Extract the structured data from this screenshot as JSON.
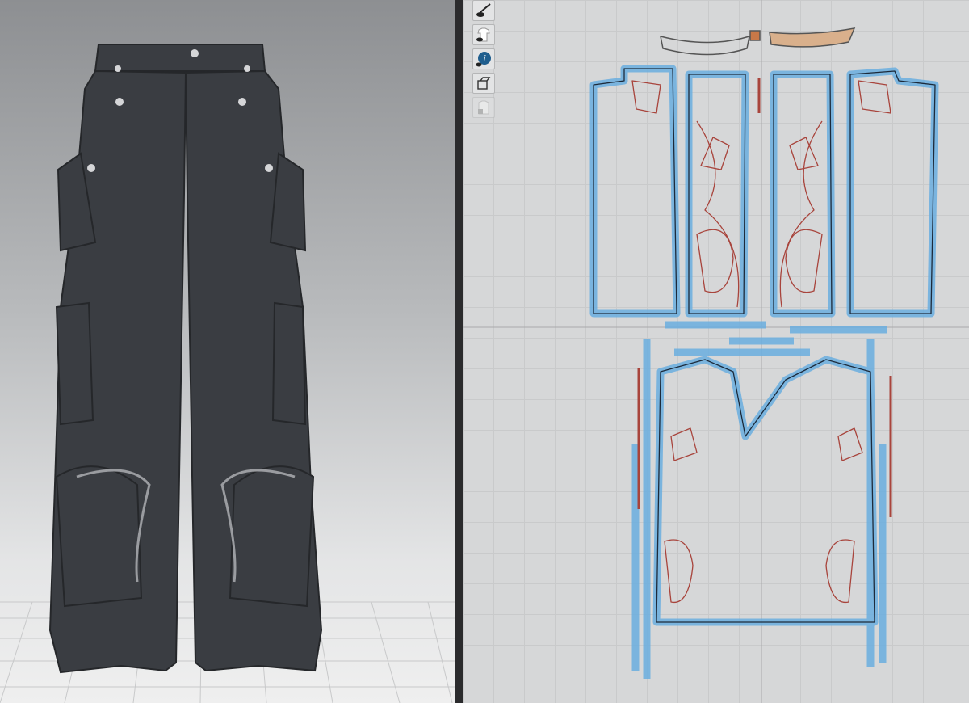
{
  "view3d": {
    "background_top": "#8d8f92",
    "background_bottom": "#efefef",
    "garment_color": "#3a3d42",
    "floor_grid": true
  },
  "view2d": {
    "background": "#d6d7d8",
    "grid_color": "#c9cacb",
    "piece_outline_color": "#6aaee0",
    "internal_line_color": "#a8443c",
    "selected_piece_fill": "#d9b08c",
    "toolbar": [
      {
        "icon": "pen-visibility-icon",
        "enabled": true
      },
      {
        "icon": "garment-visibility-icon",
        "enabled": true
      },
      {
        "icon": "info-visibility-icon",
        "enabled": true
      },
      {
        "icon": "layers-icon",
        "enabled": true
      },
      {
        "icon": "lock-garment-icon",
        "enabled": false
      }
    ]
  }
}
